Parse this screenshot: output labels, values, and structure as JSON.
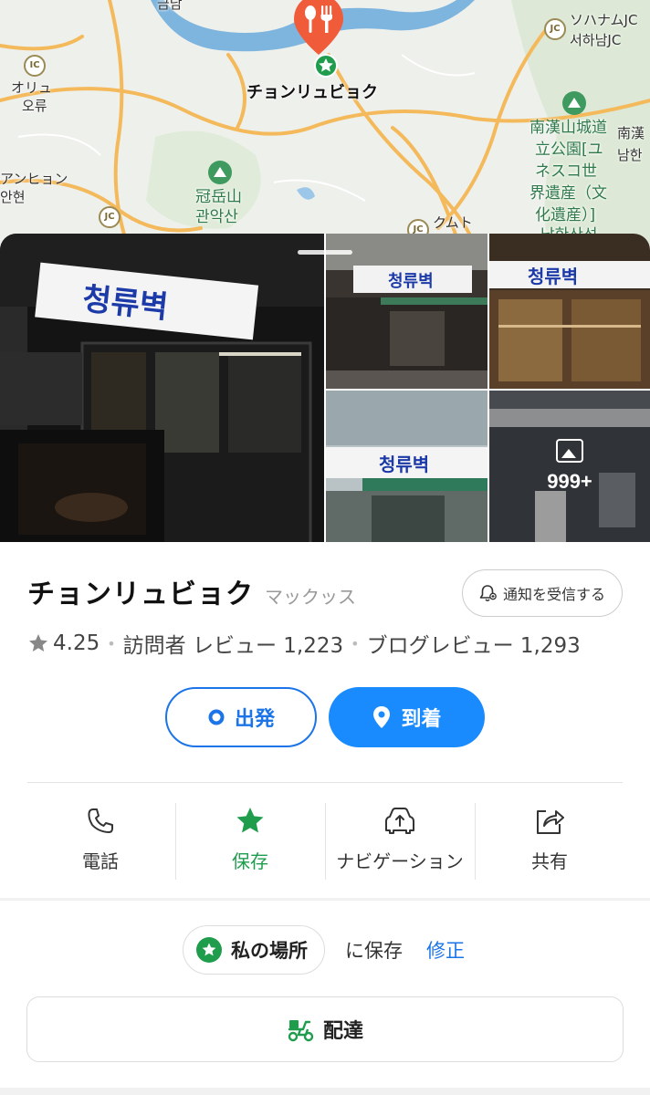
{
  "map": {
    "place_label": "チョンリュビョク",
    "labels": [
      {
        "text": "ソハナムJC",
        "style": "normal"
      },
      {
        "text": "서하남JC",
        "style": "normal"
      },
      {
        "text": "オリュ",
        "style": "normal"
      },
      {
        "text": "오류",
        "style": "normal"
      },
      {
        "text": "アンヒョン",
        "style": "normal"
      },
      {
        "text": "안현",
        "style": "normal"
      },
      {
        "text": "冠岳山",
        "style": "green"
      },
      {
        "text": "관악산",
        "style": "green"
      },
      {
        "text": "クムト",
        "style": "normal"
      },
      {
        "text": "南漢山城道",
        "style": "green"
      },
      {
        "text": "立公園[ユ",
        "style": "green"
      },
      {
        "text": "ネスコ世",
        "style": "green"
      },
      {
        "text": "界遺産（文",
        "style": "green"
      },
      {
        "text": "化遺産）]",
        "style": "green"
      },
      {
        "text": "남한산성",
        "style": "green"
      },
      {
        "text": "南漢",
        "style": "normal"
      },
      {
        "text": "남한",
        "style": "normal"
      },
      {
        "text": "금남",
        "style": "normal"
      }
    ],
    "jc_badges": [
      "IC",
      "JC",
      "JC",
      "JC",
      "IC"
    ]
  },
  "photos": {
    "more_count": "999+",
    "sign_text": "청류벽"
  },
  "place": {
    "name": "チョンリュビョク",
    "category": "マックッス",
    "notify_label": "通知を受信する",
    "rating": "4.25",
    "visitor_reviews": "訪問者 レビュー 1,223",
    "blog_reviews": "ブログレビュー 1,293",
    "separator": "•"
  },
  "route": {
    "depart_label": "出発",
    "arrive_label": "到着"
  },
  "actions": [
    {
      "label": "電話",
      "icon": "phone-icon"
    },
    {
      "label": "保存",
      "icon": "star-icon",
      "active": true
    },
    {
      "label": "ナビゲーション",
      "icon": "car-navigation-icon"
    },
    {
      "label": "共有",
      "icon": "share-icon"
    }
  ],
  "save": {
    "list_name": "私の場所",
    "saved_text": "に保存",
    "edit_label": "修正"
  },
  "delivery": {
    "label": "配達"
  },
  "colors": {
    "primary_blue": "#1a8bff",
    "saved_green": "#1f9d4d",
    "pin_red": "#f05b3a",
    "river_blue": "#7eb5de"
  }
}
